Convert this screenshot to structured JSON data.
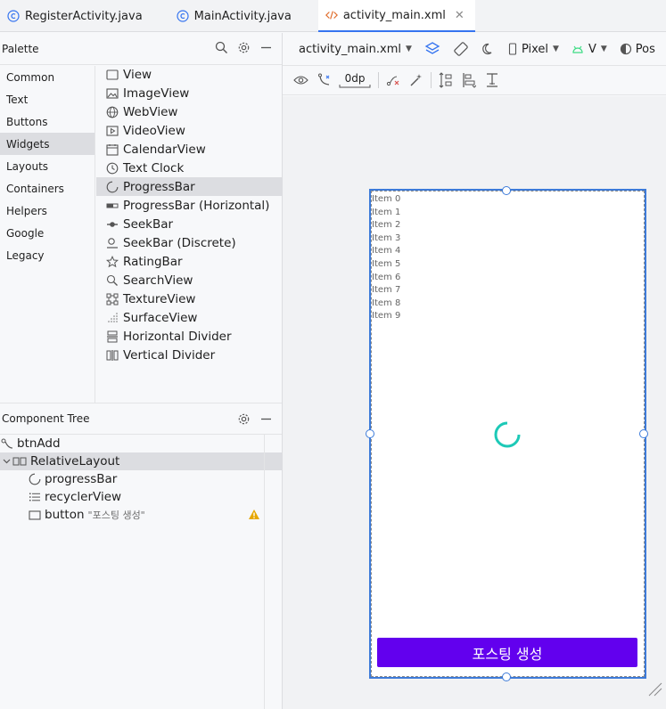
{
  "tabs": [
    {
      "label": "RegisterActivity.java",
      "icon": "class-c-icon"
    },
    {
      "label": "MainActivity.java",
      "icon": "class-c-icon"
    },
    {
      "label": "activity_main.xml",
      "icon": "xml-code-icon",
      "active": true
    }
  ],
  "palette": {
    "title": "Palette",
    "categories": [
      "Common",
      "Text",
      "Buttons",
      "Widgets",
      "Layouts",
      "Containers",
      "Helpers",
      "Google",
      "Legacy"
    ],
    "selected_category": "Widgets",
    "widgets": [
      {
        "label": "View",
        "icon": "view-icon"
      },
      {
        "label": "ImageView",
        "icon": "image-icon"
      },
      {
        "label": "WebView",
        "icon": "web-icon"
      },
      {
        "label": "VideoView",
        "icon": "video-icon"
      },
      {
        "label": "CalendarView",
        "icon": "calendar-icon"
      },
      {
        "label": "Text Clock",
        "icon": "clock-icon"
      },
      {
        "label": "ProgressBar",
        "icon": "progress-icon"
      },
      {
        "label": "ProgressBar (Horizontal)",
        "icon": "progress-horizontal-icon"
      },
      {
        "label": "SeekBar",
        "icon": "seekbar-icon"
      },
      {
        "label": "SeekBar (Discrete)",
        "icon": "seekbar-discrete-icon"
      },
      {
        "label": "RatingBar",
        "icon": "star-icon"
      },
      {
        "label": "SearchView",
        "icon": "search-icon"
      },
      {
        "label": "TextureView",
        "icon": "texture-icon"
      },
      {
        "label": "SurfaceView",
        "icon": "surface-icon"
      },
      {
        "label": "Horizontal Divider",
        "icon": "horizontal-divider-icon"
      },
      {
        "label": "Vertical Divider",
        "icon": "vertical-divider-icon"
      }
    ],
    "selected_widget": "ProgressBar"
  },
  "component_tree": {
    "title": "Component Tree",
    "nodes": [
      {
        "label": "btnAdd",
        "icon": "constraint-icon",
        "depth": 0
      },
      {
        "label": "RelativeLayout",
        "icon": "relative-layout-icon",
        "depth": 0,
        "selected": true,
        "expanded": true
      },
      {
        "label": "progressBar",
        "icon": "progress-icon",
        "depth": 1
      },
      {
        "label": "recyclerView",
        "icon": "list-icon",
        "depth": 1
      },
      {
        "label": "button",
        "icon": "button-icon",
        "depth": 1,
        "sub": "\"포스팅 생성\"",
        "warning": true
      }
    ]
  },
  "design_toolbar": {
    "file": "activity_main.xml",
    "device": "Pixel",
    "api": "V",
    "theme": "Pos",
    "margin": "0dp"
  },
  "preview": {
    "items": [
      "Item 0",
      "Item 1",
      "Item 2",
      "Item 3",
      "Item 4",
      "Item 5",
      "Item 6",
      "Item 7",
      "Item 8",
      "Item 9"
    ],
    "button_label": "포스팅 생성"
  },
  "colors": {
    "accent": "#3574f0",
    "button": "#6200ee",
    "spinner": "#1dc9b7",
    "warning": "#e6a700"
  }
}
